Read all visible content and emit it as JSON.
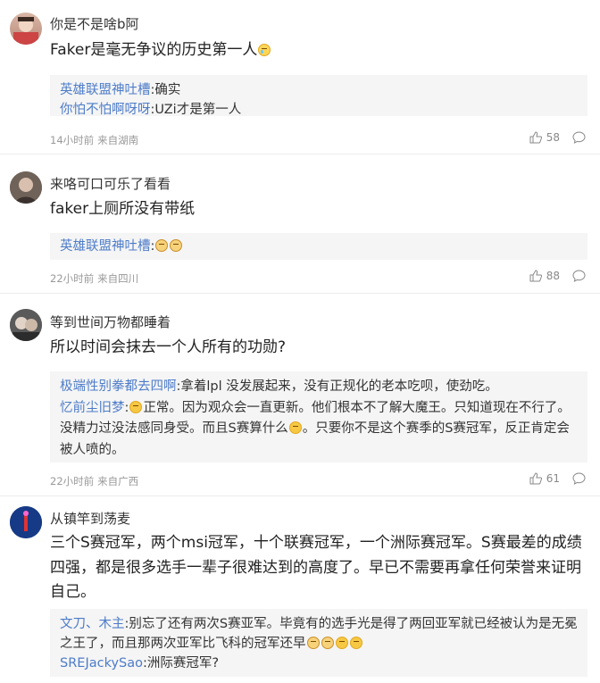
{
  "comments": [
    {
      "username": "你是不是啥b阿",
      "text": "Faker是毫无争议的历史第一人",
      "replies": [
        {
          "name": "英雄联盟神吐槽",
          "text": "确实"
        },
        {
          "name": "你怕不怕啊呀呀",
          "text": "UZi才是第一人"
        }
      ],
      "time": "14小时前",
      "location": "来自湖南",
      "likes": "58"
    },
    {
      "username": "来咯可口可乐了看看",
      "text": "faker上厕所没有带纸",
      "replies": [
        {
          "name": "英雄联盟神吐槽",
          "text": ""
        }
      ],
      "time": "22小时前",
      "location": "来自四川",
      "likes": "88"
    },
    {
      "username": "等到世间万物都睡着",
      "text": "所以时间会抹去一个人所有的功勋?",
      "replies": [
        {
          "name": "极端性别拳都去四啊",
          "text": "拿着lpl 没发展起来，没有正规化的老本吃呗，使劲吃。"
        },
        {
          "name": "忆前尘旧梦",
          "text": "正常。因为观众会一直更新。他们根本不了解大魔王。只知道现在不行了。没精力过没法感同身受。而且S赛算什么",
          "text_tail": "。只要你不是这个赛季的S赛冠军，反正肯定会被人喷的。"
        }
      ],
      "time": "22小时前",
      "location": "来自广西",
      "likes": "61"
    },
    {
      "username": "从镇竿到荡麦",
      "text": "三个S赛冠军，两个msi冠军，十个联赛冠军，一个洲际赛冠军。S赛最差的成绩四强，都是很多选手一辈子很难达到的高度了。早已不需要再拿任何荣誉来证明自己。",
      "replies": [
        {
          "name": "文刀、木主",
          "text": "别忘了还有两次S赛亚军。毕竟有的选手光是得了两回亚军就已经被认为是无冕之王了，而且那两次亚军比飞科的冠军还早"
        },
        {
          "name": "SREJackySao",
          "text": "洲际赛冠军?"
        }
      ]
    }
  ]
}
